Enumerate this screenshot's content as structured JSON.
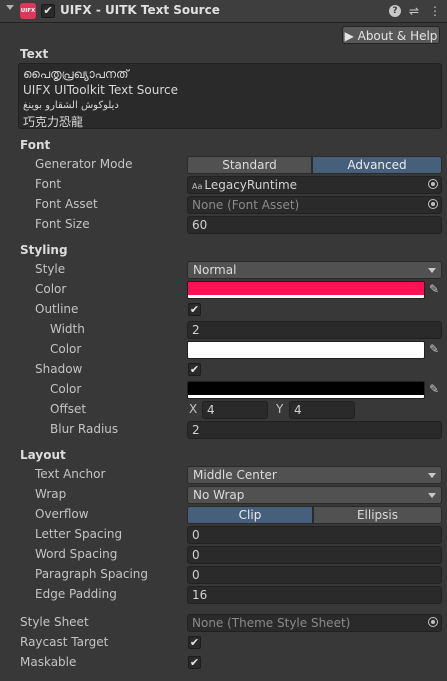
{
  "header": {
    "logo": "UIFX",
    "title": "UIFX - UITK Text Source",
    "icons": [
      "help-icon",
      "settings-sliders-icon",
      "more-vertical-icon"
    ]
  },
  "about_button": "▶ About & Help",
  "text_section": {
    "title": "Text",
    "lines": [
      "പൈതൃപ്രഖ്യാപനത്",
      "UIFX UIToolkit Text Source",
      "ديلوكوش الشقارو بوينغ",
      "巧克力恐龍"
    ]
  },
  "font_section": {
    "title": "Font",
    "generator_mode": {
      "label": "Generator Mode",
      "options": [
        "Standard",
        "Advanced"
      ],
      "selected": "Advanced"
    },
    "font": {
      "label": "Font",
      "value": "LegacyRuntime",
      "prefix": "Aa"
    },
    "font_asset": {
      "label": "Font Asset",
      "value": "None (Font Asset)"
    },
    "font_size": {
      "label": "Font Size",
      "value": "60"
    }
  },
  "styling_section": {
    "title": "Styling",
    "style": {
      "label": "Style",
      "value": "Normal"
    },
    "color": {
      "label": "Color",
      "value": "#ff1253"
    },
    "outline": {
      "label": "Outline",
      "checked": true
    },
    "outline_width": {
      "label": "Width",
      "value": "2"
    },
    "outline_color": {
      "label": "Color",
      "value": "#ffffff"
    },
    "shadow": {
      "label": "Shadow",
      "checked": true
    },
    "shadow_color": {
      "label": "Color",
      "value": "#000000"
    },
    "offset": {
      "label": "Offset",
      "x_label": "X",
      "x": "4",
      "y_label": "Y",
      "y": "4"
    },
    "blur_radius": {
      "label": "Blur Radius",
      "value": "2"
    }
  },
  "layout_section": {
    "title": "Layout",
    "text_anchor": {
      "label": "Text Anchor",
      "value": "Middle Center"
    },
    "wrap": {
      "label": "Wrap",
      "value": "No Wrap"
    },
    "overflow": {
      "label": "Overflow",
      "options": [
        "Clip",
        "Ellipsis"
      ],
      "selected": "Clip"
    },
    "letter_spacing": {
      "label": "Letter Spacing",
      "value": "0"
    },
    "word_spacing": {
      "label": "Word Spacing",
      "value": "0"
    },
    "paragraph_spacing": {
      "label": "Paragraph Spacing",
      "value": "0"
    },
    "edge_padding": {
      "label": "Edge Padding",
      "value": "16"
    }
  },
  "footer": {
    "style_sheet": {
      "label": "Style Sheet",
      "value": "None (Theme Style Sheet)"
    },
    "raycast_target": {
      "label": "Raycast Target",
      "checked": true
    },
    "maskable": {
      "label": "Maskable",
      "checked": true
    }
  },
  "check_glyph": "✔"
}
